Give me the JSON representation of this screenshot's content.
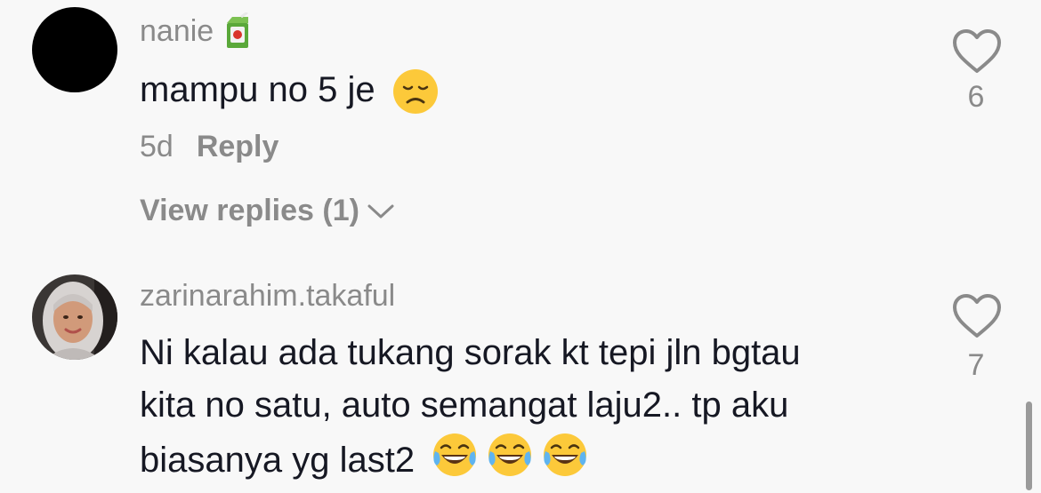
{
  "comments": [
    {
      "username": "nanie",
      "username_emoji": "juice-box-icon",
      "text": "mampu no 5 je",
      "text_emoji": "disappointed-face-icon",
      "age": "5d",
      "reply_label": "Reply",
      "view_replies_label": "View replies (1)",
      "likes": "6",
      "avatar": "black-circle"
    },
    {
      "username": "zarinarahim.takaful",
      "text_lines": [
        "Ni kalau ada tukang sorak kt tepi jln bgtau",
        "kita no satu, auto semangat laju2.. tp aku",
        "biasanya yg last2"
      ],
      "text_emoji": "tears-of-joy-icon",
      "likes": "7",
      "avatar": "profile-photo"
    }
  ],
  "colors": {
    "background": "#f8f8f8",
    "secondary_text": "#8a8a8a",
    "primary_text": "#161823"
  }
}
